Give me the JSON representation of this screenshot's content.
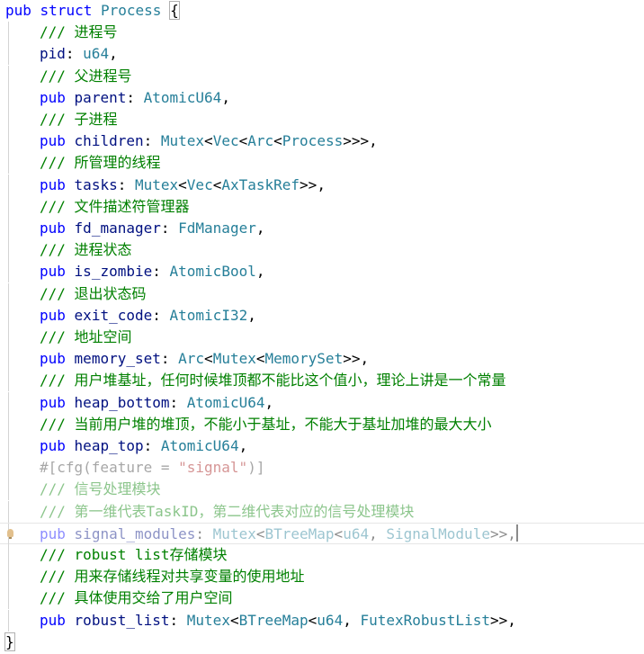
{
  "editor": {
    "lines": [
      {
        "tokens": [
          {
            "c": "k",
            "t": "pub"
          },
          {
            "c": "p",
            "t": " "
          },
          {
            "c": "k",
            "t": "struct"
          },
          {
            "c": "p",
            "t": " "
          },
          {
            "c": "t",
            "t": "Process"
          },
          {
            "c": "p",
            "t": " "
          },
          {
            "c": "p bracket-hl",
            "t": "{"
          }
        ]
      },
      {
        "tokens": [
          {
            "c": "c",
            "t": "/// 进程号"
          }
        ]
      },
      {
        "tokens": [
          {
            "c": "f",
            "t": "pid"
          },
          {
            "c": "p",
            "t": ": "
          },
          {
            "c": "t",
            "t": "u64"
          },
          {
            "c": "p",
            "t": ","
          }
        ]
      },
      {
        "tokens": [
          {
            "c": "c",
            "t": "/// 父进程号"
          }
        ]
      },
      {
        "tokens": [
          {
            "c": "k",
            "t": "pub"
          },
          {
            "c": "p",
            "t": " "
          },
          {
            "c": "f",
            "t": "parent"
          },
          {
            "c": "p",
            "t": ": "
          },
          {
            "c": "t",
            "t": "AtomicU64"
          },
          {
            "c": "p",
            "t": ","
          }
        ]
      },
      {
        "tokens": [
          {
            "c": "c",
            "t": "/// 子进程"
          }
        ]
      },
      {
        "tokens": [
          {
            "c": "k",
            "t": "pub"
          },
          {
            "c": "p",
            "t": " "
          },
          {
            "c": "f",
            "t": "children"
          },
          {
            "c": "p",
            "t": ": "
          },
          {
            "c": "t",
            "t": "Mutex"
          },
          {
            "c": "p",
            "t": "<"
          },
          {
            "c": "t",
            "t": "Vec"
          },
          {
            "c": "p",
            "t": "<"
          },
          {
            "c": "t",
            "t": "Arc"
          },
          {
            "c": "p",
            "t": "<"
          },
          {
            "c": "t",
            "t": "Process"
          },
          {
            "c": "p",
            "t": ">>>,"
          }
        ]
      },
      {
        "tokens": [
          {
            "c": "c",
            "t": "/// 所管理的线程"
          }
        ]
      },
      {
        "tokens": [
          {
            "c": "k",
            "t": "pub"
          },
          {
            "c": "p",
            "t": " "
          },
          {
            "c": "f",
            "t": "tasks"
          },
          {
            "c": "p",
            "t": ": "
          },
          {
            "c": "t",
            "t": "Mutex"
          },
          {
            "c": "p",
            "t": "<"
          },
          {
            "c": "t",
            "t": "Vec"
          },
          {
            "c": "p",
            "t": "<"
          },
          {
            "c": "t",
            "t": "AxTaskRef"
          },
          {
            "c": "p",
            "t": ">>,"
          }
        ]
      },
      {
        "tokens": [
          {
            "c": "c",
            "t": "/// 文件描述符管理器"
          }
        ]
      },
      {
        "tokens": [
          {
            "c": "k",
            "t": "pub"
          },
          {
            "c": "p",
            "t": " "
          },
          {
            "c": "f",
            "t": "fd_manager"
          },
          {
            "c": "p",
            "t": ": "
          },
          {
            "c": "t",
            "t": "FdManager"
          },
          {
            "c": "p",
            "t": ","
          }
        ]
      },
      {
        "tokens": [
          {
            "c": "c",
            "t": "/// 进程状态"
          }
        ]
      },
      {
        "tokens": [
          {
            "c": "k",
            "t": "pub"
          },
          {
            "c": "p",
            "t": " "
          },
          {
            "c": "f",
            "t": "is_zombie"
          },
          {
            "c": "p",
            "t": ": "
          },
          {
            "c": "t",
            "t": "AtomicBool"
          },
          {
            "c": "p",
            "t": ","
          }
        ]
      },
      {
        "tokens": [
          {
            "c": "c",
            "t": "/// 退出状态码"
          }
        ]
      },
      {
        "tokens": [
          {
            "c": "k",
            "t": "pub"
          },
          {
            "c": "p",
            "t": " "
          },
          {
            "c": "f",
            "t": "exit_code"
          },
          {
            "c": "p",
            "t": ": "
          },
          {
            "c": "t",
            "t": "AtomicI32"
          },
          {
            "c": "p",
            "t": ","
          }
        ]
      },
      {
        "tokens": [
          {
            "c": "c",
            "t": "/// 地址空间"
          }
        ]
      },
      {
        "tokens": [
          {
            "c": "k",
            "t": "pub"
          },
          {
            "c": "p",
            "t": " "
          },
          {
            "c": "f",
            "t": "memory_set"
          },
          {
            "c": "p",
            "t": ": "
          },
          {
            "c": "t",
            "t": "Arc"
          },
          {
            "c": "p",
            "t": "<"
          },
          {
            "c": "t",
            "t": "Mutex"
          },
          {
            "c": "p",
            "t": "<"
          },
          {
            "c": "t",
            "t": "MemorySet"
          },
          {
            "c": "p",
            "t": ">>,"
          }
        ]
      },
      {
        "tokens": [
          {
            "c": "c",
            "t": "/// 用户堆基址，任何时候堆顶都不能比这个值小，理论上讲是一个常量"
          }
        ]
      },
      {
        "tokens": [
          {
            "c": "k",
            "t": "pub"
          },
          {
            "c": "p",
            "t": " "
          },
          {
            "c": "f",
            "t": "heap_bottom"
          },
          {
            "c": "p",
            "t": ": "
          },
          {
            "c": "t",
            "t": "AtomicU64"
          },
          {
            "c": "p",
            "t": ","
          }
        ]
      },
      {
        "tokens": [
          {
            "c": "c",
            "t": "/// 当前用户堆的堆顶，不能小于基址，不能大于基址加堆的最大大小"
          }
        ]
      },
      {
        "tokens": [
          {
            "c": "k",
            "t": "pub"
          },
          {
            "c": "p",
            "t": " "
          },
          {
            "c": "f",
            "t": "heap_top"
          },
          {
            "c": "p",
            "t": ": "
          },
          {
            "c": "t",
            "t": "AtomicU64"
          },
          {
            "c": "p",
            "t": ","
          }
        ]
      },
      {
        "dim": true,
        "tokens": [
          {
            "c": "a",
            "t": "#[cfg(feature = "
          },
          {
            "c": "s",
            "t": "\"signal\""
          },
          {
            "c": "a",
            "t": ")]"
          }
        ]
      },
      {
        "dim": true,
        "tokens": [
          {
            "c": "c",
            "t": "/// 信号处理模块"
          }
        ]
      },
      {
        "dim": true,
        "tokens": [
          {
            "c": "c",
            "t": "/// 第一维代表TaskID，第二维代表对应的信号处理模块"
          }
        ]
      },
      {
        "dim": true,
        "current": true,
        "bulb": true,
        "cursor": true,
        "tokens": [
          {
            "c": "k",
            "t": "pub"
          },
          {
            "c": "p",
            "t": " "
          },
          {
            "c": "f",
            "t": "signal_modules"
          },
          {
            "c": "p",
            "t": ": "
          },
          {
            "c": "t",
            "t": "Mutex"
          },
          {
            "c": "p",
            "t": "<"
          },
          {
            "c": "t",
            "t": "BTreeMap"
          },
          {
            "c": "p",
            "t": "<"
          },
          {
            "c": "t",
            "t": "u64"
          },
          {
            "c": "p",
            "t": ", "
          },
          {
            "c": "t",
            "t": "SignalModule"
          },
          {
            "c": "p",
            "t": ">>,"
          }
        ]
      },
      {
        "tokens": [
          {
            "c": "c",
            "t": "/// robust list存储模块"
          }
        ]
      },
      {
        "tokens": [
          {
            "c": "c",
            "t": "/// 用来存储线程对共享变量的使用地址"
          }
        ]
      },
      {
        "tokens": [
          {
            "c": "c",
            "t": "/// 具体使用交给了用户空间"
          }
        ]
      },
      {
        "tokens": [
          {
            "c": "k",
            "t": "pub"
          },
          {
            "c": "p",
            "t": " "
          },
          {
            "c": "f",
            "t": "robust_list"
          },
          {
            "c": "p",
            "t": ": "
          },
          {
            "c": "t",
            "t": "Mutex"
          },
          {
            "c": "p",
            "t": "<"
          },
          {
            "c": "t",
            "t": "BTreeMap"
          },
          {
            "c": "p",
            "t": "<"
          },
          {
            "c": "t",
            "t": "u64"
          },
          {
            "c": "p",
            "t": ", "
          },
          {
            "c": "t",
            "t": "FutexRobustList"
          },
          {
            "c": "p",
            "t": ">>,"
          }
        ]
      },
      {
        "tokens": [
          {
            "c": "p bracket-hl",
            "t": "}"
          }
        ]
      }
    ]
  }
}
